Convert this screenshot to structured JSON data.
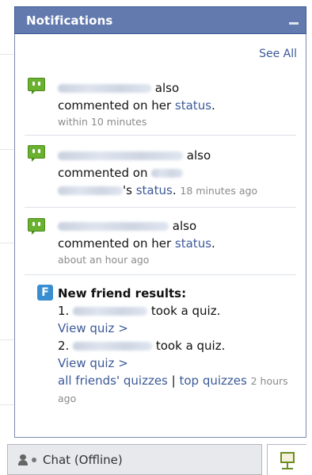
{
  "panel": {
    "title": "Notifications",
    "see_all": "See All"
  },
  "notifications": [
    {
      "type": "comment",
      "icon": "comment-icon",
      "text_after_name": "also",
      "line2": "commented on her",
      "link": "status",
      "punct": ".",
      "time": "within 10 minutes"
    },
    {
      "type": "comment",
      "icon": "comment-icon",
      "text_after_name": "also",
      "line2": "commented on",
      "possessive": "'s",
      "link": "status",
      "punct": ".",
      "time": "18 minutes ago"
    },
    {
      "type": "comment",
      "icon": "comment-icon",
      "text_after_name": "also",
      "line2": "commented on her",
      "link": "status",
      "punct": ".",
      "time": "about an hour ago"
    }
  ],
  "quiz": {
    "icon": "quiz-app-icon",
    "icon_letter": "F",
    "heading": "New friend results:",
    "item1_num": "1.",
    "item1_text": "took a quiz.",
    "item1_link": "View quiz >",
    "item2_num": "2.",
    "item2_text": "took a quiz.",
    "item2_link": "View quiz >",
    "all_link": "all friends' quizzes",
    "separator": "|",
    "top_link": "top quizzes",
    "time": "2 hours ago"
  },
  "chat": {
    "label": "Chat (Offline)"
  },
  "colors": {
    "header": "#627aad",
    "link": "#3b5998",
    "comment_icon": "#6bb130"
  }
}
